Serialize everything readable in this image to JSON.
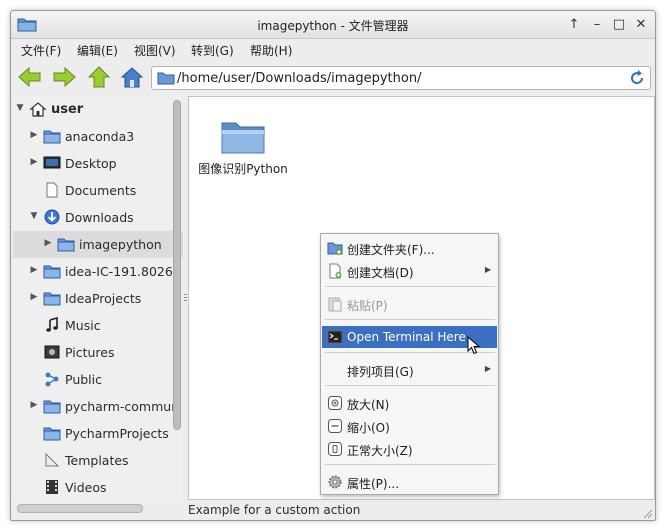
{
  "window": {
    "title": "imagepython - 文件管理器",
    "buttons": {
      "up": "↑",
      "minimize": "–",
      "maximize": "□",
      "close": "✕"
    }
  },
  "menubar": [
    "文件(F)",
    "编辑(E)",
    "视图(V)",
    "转到(G)",
    "帮助(H)"
  ],
  "toolbar": {
    "back_icon": "back-arrow-icon",
    "forward_icon": "forward-arrow-icon",
    "up_icon": "up-arrow-icon",
    "home_icon": "home-icon",
    "path": "/home/user/Downloads/imagepython/",
    "reload_icon": "reload-icon"
  },
  "sidebar": {
    "root": "user",
    "items": [
      {
        "label": "anaconda3",
        "icon": "folder-icon",
        "expandable": true
      },
      {
        "label": "Desktop",
        "icon": "desktop-icon",
        "expandable": true
      },
      {
        "label": "Documents",
        "icon": "document-icon",
        "expandable": false
      },
      {
        "label": "Downloads",
        "icon": "downloads-icon",
        "expanded": true
      },
      {
        "label": "imagepython",
        "icon": "folder-icon",
        "expandable": true,
        "selected": true
      },
      {
        "label": "idea-IC-191.8026",
        "icon": "folder-icon",
        "expandable": true
      },
      {
        "label": "IdeaProjects",
        "icon": "folder-icon",
        "expandable": true
      },
      {
        "label": "Music",
        "icon": "music-icon",
        "expandable": false
      },
      {
        "label": "Pictures",
        "icon": "pictures-icon",
        "expandable": false
      },
      {
        "label": "Public",
        "icon": "public-share-icon",
        "expandable": false
      },
      {
        "label": "pycharm-commun",
        "icon": "folder-icon",
        "expandable": true
      },
      {
        "label": "PycharmProjects",
        "icon": "folder-icon",
        "expandable": false
      },
      {
        "label": "Templates",
        "icon": "templates-icon",
        "expandable": false
      },
      {
        "label": "Videos",
        "icon": "videos-icon",
        "expandable": false
      }
    ]
  },
  "main": {
    "files": [
      {
        "name": "图像识别Python",
        "icon": "folder-icon"
      }
    ]
  },
  "context_menu": {
    "items": [
      {
        "label": "创建文件夹(F)...",
        "icon": "new-folder-icon"
      },
      {
        "label": "创建文档(D)",
        "icon": "new-document-icon",
        "submenu": true
      },
      {
        "label": "粘贴(P)",
        "icon": "paste-icon",
        "disabled": true
      },
      {
        "label": "Open Terminal Here",
        "icon": "terminal-icon",
        "highlighted": true
      },
      {
        "label": "排列项目(G)",
        "icon": "",
        "submenu": true
      },
      {
        "label": "放大(N)",
        "icon": "zoom-in-icon"
      },
      {
        "label": "缩小(O)",
        "icon": "zoom-out-icon"
      },
      {
        "label": "正常大小(Z)",
        "icon": "zoom-normal-icon"
      },
      {
        "label": "属性(P)...",
        "icon": "properties-icon"
      }
    ]
  },
  "statusbar": {
    "text": "Example for a custom action"
  },
  "colors": {
    "highlight": "#3b6fc4",
    "folder": "#5a8fcf",
    "toolbar_green": "#8cc63f"
  }
}
